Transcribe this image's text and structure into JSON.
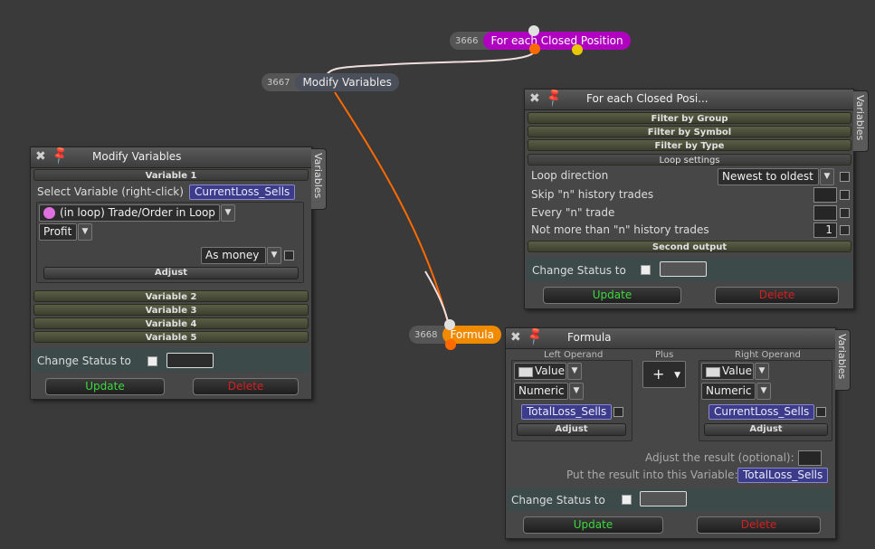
{
  "nodes": {
    "closed": {
      "id": "3666",
      "label": "For each Closed Position",
      "color": "#b000c0"
    },
    "modify": {
      "id": "3667",
      "label": "Modify Variables"
    },
    "formula": {
      "id": "3668",
      "label": "Formula",
      "color": "#f08a00"
    }
  },
  "modify_panel": {
    "title": "Modify Variables",
    "side_tab": "Variables",
    "variable1": "Variable 1",
    "select_label": "Select Variable (right-click)",
    "select_value": "CurrentLoss_Sells",
    "source": "(in loop) Trade/Order in Loop",
    "property": "Profit",
    "mode": "As money",
    "adjust": "Adjust",
    "variables": [
      "Variable 2",
      "Variable 3",
      "Variable 4",
      "Variable 5"
    ],
    "change_status": "Change Status to",
    "update": "Update",
    "delete": "Delete"
  },
  "closed_panel": {
    "title": "For each Closed Posi...",
    "side_tab": "Variables",
    "sections": [
      "Filter by Group",
      "Filter by Symbol",
      "Filter by Type"
    ],
    "loop_settings": "Loop settings",
    "loop_direction_label": "Loop direction",
    "loop_direction_value": "Newest to oldest",
    "skip_label": "Skip \"n\" history trades",
    "every_label": "Every \"n\" trade",
    "not_more_label": "Not more than \"n\" history trades",
    "not_more_value": "1",
    "second_output": "Second output",
    "change_status": "Change Status to",
    "update": "Update",
    "delete": "Delete"
  },
  "formula_panel": {
    "title": "Formula",
    "side_tab": "Variables",
    "left_operand": "Left Operand",
    "plus": "Plus",
    "right_operand": "Right Operand",
    "operator": "+",
    "left_type": "Value",
    "left_kind": "Numeric",
    "left_var": "TotalLoss_Sells",
    "right_type": "Value",
    "right_kind": "Numeric",
    "right_var": "CurrentLoss_Sells",
    "adjust": "Adjust",
    "adjust_result": "Adjust the result (optional):",
    "put_result": "Put the result into this Variable:",
    "result_var": "TotalLoss_Sells",
    "change_status": "Change Status to",
    "update": "Update",
    "delete": "Delete"
  },
  "colors": {
    "update": "#3fd83f",
    "delete": "#d42020",
    "field": "#3c3c8a",
    "wire": "#ff6a00"
  }
}
